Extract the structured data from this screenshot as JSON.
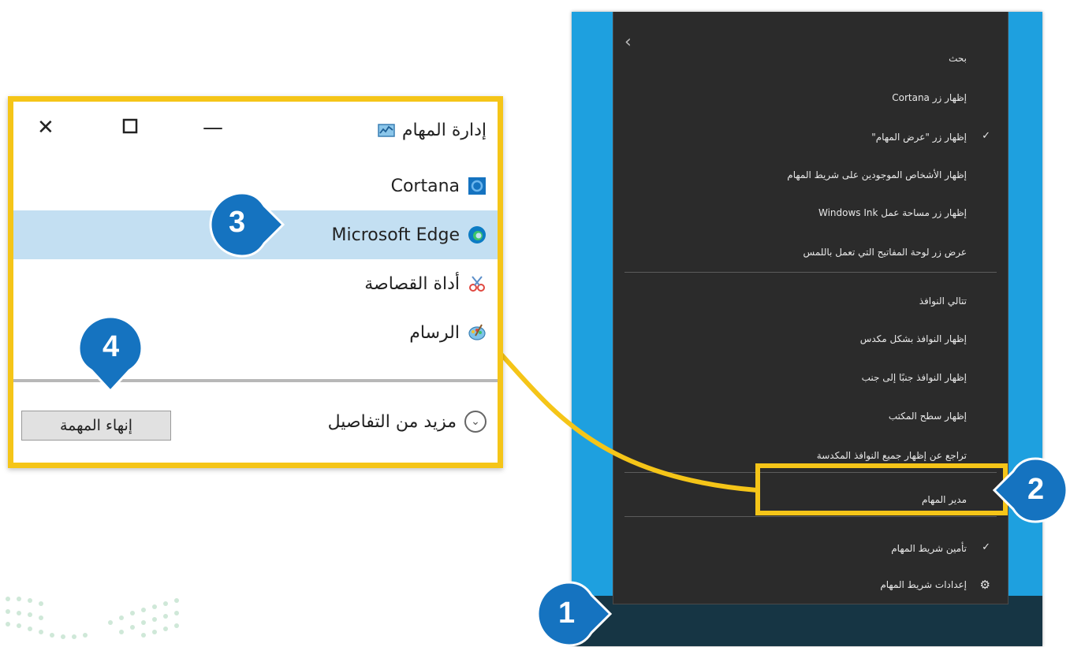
{
  "context_menu": {
    "items": [
      {
        "label": "بحث",
        "checked": false
      },
      {
        "label": "إظهار زر Cortana",
        "checked": false
      },
      {
        "label": "إظهار زر \"عرض المهام\"",
        "checked": true
      },
      {
        "label": "إظهار الأشخاص الموجودين على شريط المهام",
        "checked": false
      },
      {
        "label": "إظهار زر مساحة عمل Windows Ink",
        "checked": false
      },
      {
        "label": "عرض زر لوحة المفاتيح التي تعمل باللمس",
        "checked": false
      },
      {
        "label": "تتالي النوافذ",
        "checked": false
      },
      {
        "label": "إظهار النوافذ بشكل مكدس",
        "checked": false
      },
      {
        "label": "إظهار النوافذ جنبًا إلى جنب",
        "checked": false
      },
      {
        "label": "إظهار سطح المكتب",
        "checked": false
      },
      {
        "label": "تراجع عن إظهار جميع النوافذ المكدسة",
        "checked": false
      },
      {
        "label": "مدير المهام",
        "checked": false
      },
      {
        "label": "تأمين شريط المهام",
        "checked": true
      },
      {
        "label": "إعدادات شريط المهام",
        "checked": false
      }
    ]
  },
  "task_manager": {
    "title": "إدارة المهام",
    "apps": [
      {
        "label": "Cortana",
        "icon": "cortana-icon",
        "selected": false
      },
      {
        "label": "Microsoft Edge",
        "icon": "edge-icon",
        "selected": true
      },
      {
        "label": "أداة القصاصة",
        "icon": "snipping-tool-icon",
        "selected": false
      },
      {
        "label": "الرسام",
        "icon": "paint-icon",
        "selected": false
      }
    ],
    "more_details": "مزيد من التفاصيل",
    "end_task": "إنهاء المهمة"
  },
  "badges": {
    "b1": "1",
    "b2": "2",
    "b3": "3",
    "b4": "4"
  },
  "colors": {
    "accent_yellow": "#f5c518",
    "badge_blue": "#1573c0",
    "desktop_blue": "#1ea0df",
    "menu_bg": "#2b2b2b",
    "selected_row": "#c3dff2"
  }
}
